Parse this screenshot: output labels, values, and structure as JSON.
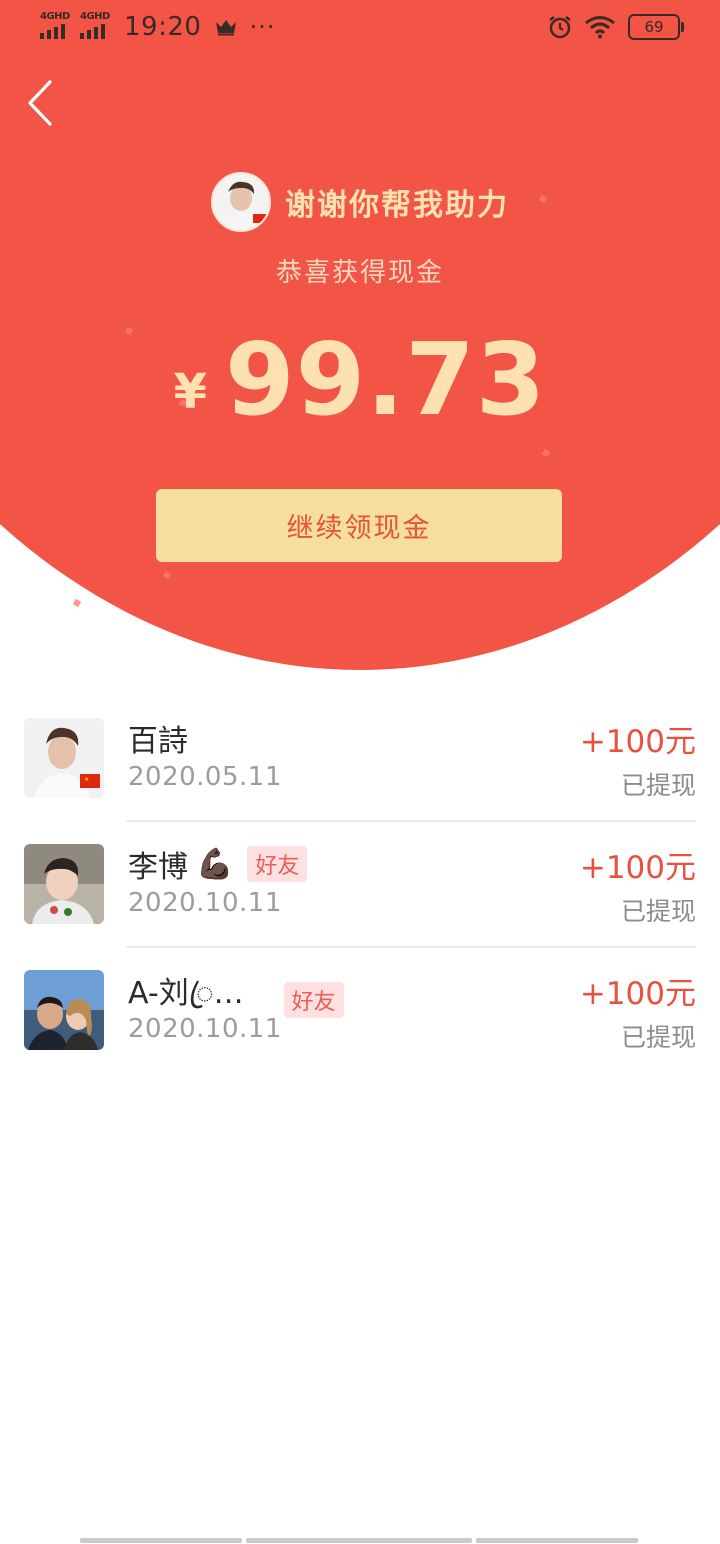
{
  "status_bar": {
    "signal_1_label": "4GHD",
    "signal_2_label": "4GHD",
    "time": "19:20",
    "more": "···",
    "battery": "69"
  },
  "hero": {
    "title": "谢谢你帮我助力",
    "subtitle": "恭喜获得现金",
    "currency": "¥",
    "amount": "99.73",
    "button_label": "继续领现金"
  },
  "records": [
    {
      "name": "百詩",
      "emoji": "",
      "tag": "",
      "date": "2020.05.11",
      "reward": "+100元",
      "status": "已提现"
    },
    {
      "name": "李博",
      "emoji": "💪🏿",
      "tag": "好友",
      "date": "2020.10.11",
      "reward": "+100元",
      "status": "已提现"
    },
    {
      "name": "A-刘ꦿ…",
      "emoji": "",
      "tag": "好友",
      "date": "2020.10.11",
      "reward": "+100元",
      "status": "已提现"
    }
  ],
  "colors": {
    "hero_red": "#f25546",
    "gold_text": "#fde1b0",
    "button_bg": "#f5df9e",
    "accent_red": "#e7513e",
    "tag_bg": "#fde1e0"
  }
}
